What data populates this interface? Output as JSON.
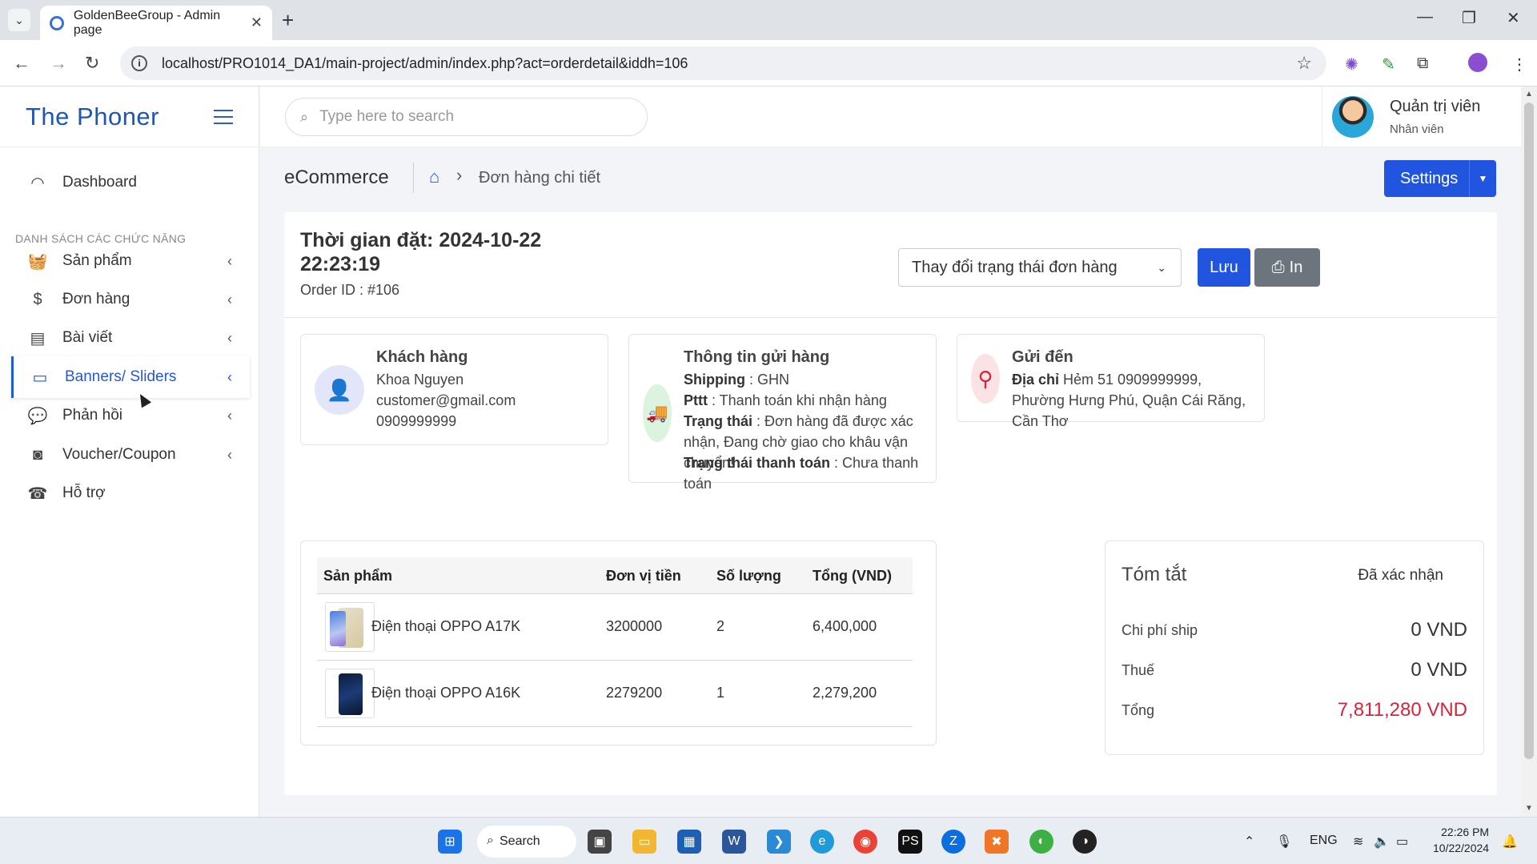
{
  "browser": {
    "tab_title": "GoldenBeeGroup - Admin page",
    "url": "localhost/PRO1014_DA1/main-project/admin/index.php?act=orderdetail&iddh=106"
  },
  "sidebar": {
    "brand": "The Phoner",
    "section_label": "DANH SÁCH CÁC CHỨC NĂNG",
    "items": [
      {
        "label": "Dashboard"
      },
      {
        "label": "Sản phẩm"
      },
      {
        "label": "Đơn hàng"
      },
      {
        "label": "Bài viết"
      },
      {
        "label": "Banners/ Sliders"
      },
      {
        "label": "Phản hồi"
      },
      {
        "label": "Voucher/Coupon"
      },
      {
        "label": "Hỗ trợ"
      }
    ]
  },
  "header": {
    "search_placeholder": "Type here to search",
    "user_name": "Quản trị viên",
    "user_role": "Nhân viên"
  },
  "page": {
    "section": "eCommerce",
    "breadcrumb": "Đơn hàng chi tiết",
    "settings_label": "Settings"
  },
  "order": {
    "time_label": "Thời gian đặt: 2024-10-22 22:23:19",
    "order_id": "Order ID : #106",
    "status_select": "Thay đổi trạng thái đơn hàng",
    "save_label": "Lưu",
    "print_label": "In"
  },
  "customer": {
    "title": "Khách hàng",
    "name": "Khoa Nguyen",
    "email": "customer@gmail.com",
    "phone": "0909999999"
  },
  "shipping": {
    "title": "Thông tin gửi hàng",
    "shipping_key": "Shipping",
    "shipping_val": " : GHN",
    "pttt_key": "Pttt",
    "pttt_val": " : Thanh toán khi nhận hàng",
    "status_key": "Trạng thái",
    "status_val": " : Đơn hàng đã được xác nhận, Đang chờ giao cho khâu vận chuyển!",
    "pay_status_key": "Trạng thái thanh toán",
    "pay_status_val": " : Chưa thanh toán"
  },
  "destination": {
    "title": "Gửi đến",
    "addr_key": "Địa chỉ",
    "addr_val": " Hẻm 51 0909999999, Phường Hưng Phú, Quận Cái Răng, Cần Thơ"
  },
  "products": {
    "headers": [
      "Sản phẩm",
      "Đơn vị tiền",
      "Số lượng",
      "Tổng (VND)"
    ],
    "rows": [
      {
        "name": "Điện thoại OPPO A17K",
        "price": "3200000",
        "qty": "2",
        "total": "6,400,000"
      },
      {
        "name": "Điện thoại OPPO A16K",
        "price": "2279200",
        "qty": "1",
        "total": "2,279,200"
      }
    ]
  },
  "summary": {
    "title": "Tóm tắt",
    "status": "Đã xác nhận",
    "ship_label": "Chi phí ship",
    "ship_val": "0 VND",
    "tax_label": "Thuế",
    "tax_val": "0 VND",
    "total_label": "Tổng",
    "total_val": "7,811,280 VND"
  },
  "taskbar": {
    "search_label": "Search",
    "lang": "ENG",
    "time": "22:26 PM",
    "date": "10/22/2024"
  },
  "colors": {
    "accent": "#2155e0",
    "brand": "#1f56b4",
    "total_red": "#d0283a"
  }
}
